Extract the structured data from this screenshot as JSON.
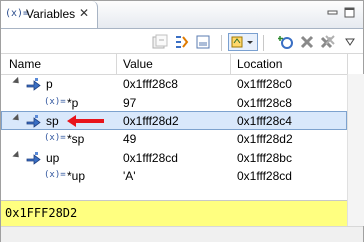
{
  "tab": {
    "icon": "(x)=",
    "title": "Variables",
    "close": "✕"
  },
  "toolbar": {
    "buttons": [
      "collapse-all-icon",
      "show-type-names-icon",
      "layout-icon",
      "select-columns-icon",
      "view-menu-icon",
      "add-global-variables-icon",
      "remove-global-variables-icon",
      "remove-all-global-variables-icon"
    ]
  },
  "columns": {
    "name": "Name",
    "value": "Value",
    "location": "Location"
  },
  "rows": [
    {
      "name": "p",
      "value": "0x1fff28c8",
      "location": "0x1fff28c0",
      "kind": "pointer",
      "expanded": true
    },
    {
      "name": "*p",
      "value": "97",
      "location": "0x1fff28c8",
      "kind": "local"
    },
    {
      "name": "sp",
      "value": "0x1fff28d2",
      "location": "0x1fff28c4",
      "kind": "pointer",
      "expanded": true,
      "selected": true
    },
    {
      "name": "*sp",
      "value": "49",
      "location": "0x1fff28d2",
      "kind": "local"
    },
    {
      "name": "up",
      "value": "0x1fff28cd",
      "location": "0x1fff28bc",
      "kind": "pointer",
      "expanded": true
    },
    {
      "name": "*up",
      "value": "'A'",
      "location": "0x1fff28cd",
      "kind": "local"
    }
  ],
  "detail": {
    "text": "0x1FFF28D2"
  },
  "colors": {
    "selection": "#d9e8fb",
    "detail_bg": "#ffff80",
    "arrow": "#e8141b"
  }
}
